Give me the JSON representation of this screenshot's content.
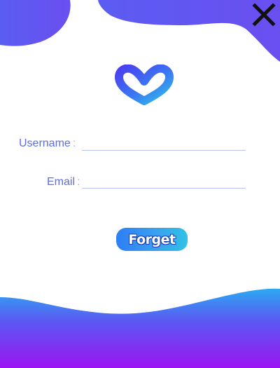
{
  "form": {
    "username_label": "Username",
    "email_label": "Email",
    "colon": ":",
    "username_value": "",
    "email_value": "",
    "submit_label": "Forget"
  },
  "icons": {
    "close": "close-icon",
    "logo": "heart-logo-icon"
  },
  "colors": {
    "label": "#5a6fe0",
    "top_blob": "#5b5cf2",
    "bottom_gradient_top": "#2ca9f2",
    "bottom_gradient_bottom": "#9b14f2",
    "button_start": "#2f7ef6",
    "button_end": "#2fc2e6"
  }
}
